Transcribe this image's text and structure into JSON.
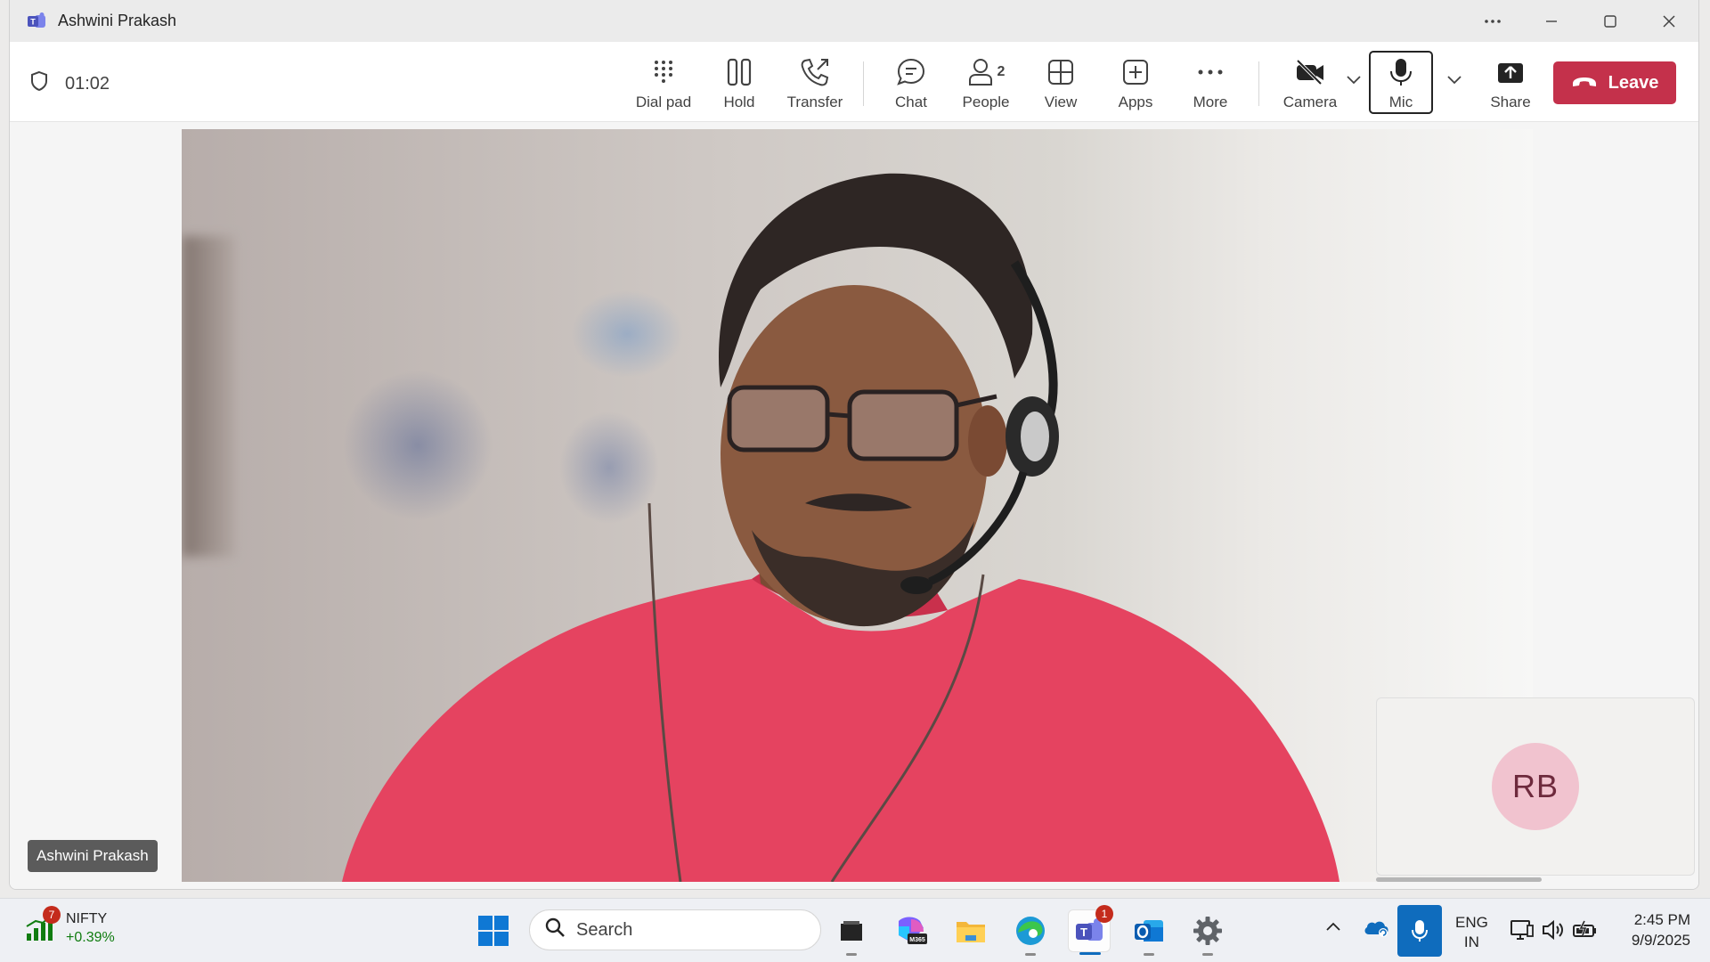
{
  "window": {
    "title": "Ashwini Prakash",
    "icons": {
      "app": "teams-icon",
      "more": "more-dots-icon",
      "minimize": "minimize-icon",
      "maximize": "maximize-icon",
      "close": "close-icon"
    }
  },
  "call": {
    "timer": "01:02",
    "timer_icon": "shield-icon"
  },
  "toolbar": {
    "dialpad": {
      "label": "Dial pad",
      "icon": "dialpad-icon"
    },
    "hold": {
      "label": "Hold",
      "icon": "pause-icon"
    },
    "transfer": {
      "label": "Transfer",
      "icon": "phone-transfer-icon"
    },
    "chat": {
      "label": "Chat",
      "icon": "chat-icon"
    },
    "people": {
      "label": "People",
      "icon": "people-icon",
      "count": "2"
    },
    "view": {
      "label": "View",
      "icon": "grid-icon"
    },
    "apps": {
      "label": "Apps",
      "icon": "add-square-icon"
    },
    "more": {
      "label": "More",
      "icon": "more-dots-icon"
    },
    "camera": {
      "label": "Camera",
      "icon": "camera-off-icon"
    },
    "mic": {
      "label": "Mic",
      "icon": "mic-icon"
    },
    "share": {
      "label": "Share",
      "icon": "share-up-icon"
    },
    "leave": {
      "label": "Leave",
      "icon": "hang-up-icon",
      "color": "#c4314b"
    }
  },
  "stage": {
    "participant_name": "Ashwini Prakash",
    "self_initials": "RB",
    "avatar_color": "#f1c3cf"
  },
  "taskbar": {
    "widget": {
      "badge": "7",
      "name": "NIFTY",
      "value": "+0.39%",
      "value_color": "#107c10"
    },
    "search_placeholder": "Search",
    "apps": [
      {
        "name": "file-explorer-dark-icon"
      },
      {
        "name": "m365-icon",
        "label": "M365"
      },
      {
        "name": "folder-icon"
      },
      {
        "name": "edge-icon"
      },
      {
        "name": "teams-icon",
        "badge": "1",
        "active": true
      },
      {
        "name": "outlook-icon"
      },
      {
        "name": "settings-icon"
      }
    ],
    "tray": {
      "lang_line1": "ENG",
      "lang_line2": "IN",
      "time": "2:45 PM",
      "date": "9/9/2025"
    }
  }
}
